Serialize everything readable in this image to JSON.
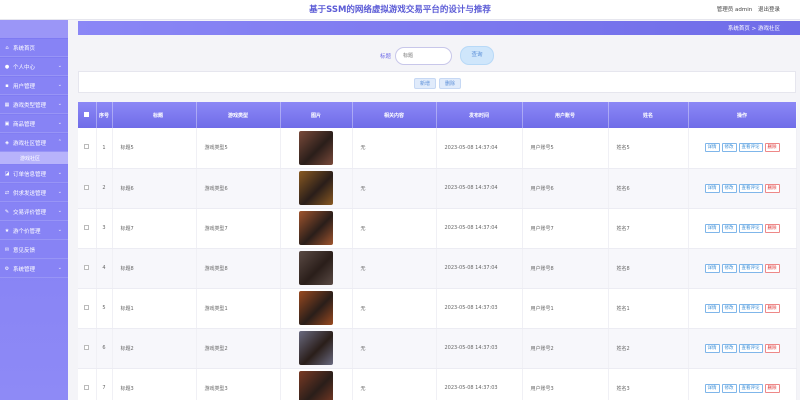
{
  "app": {
    "title": "基于SSM的网络虚拟游戏交易平台的设计与推荐",
    "user_label": "管理员 admin",
    "logout": "退出登录"
  },
  "sidebar": {
    "items": [
      {
        "label": "系统首页",
        "icon": "home-icon",
        "arrow": false
      },
      {
        "label": "个人中心",
        "icon": "user-icon",
        "arrow": true
      },
      {
        "label": "用户管理",
        "icon": "users-icon",
        "arrow": true
      },
      {
        "label": "游戏类型管理",
        "icon": "list-icon",
        "arrow": true
      },
      {
        "label": "商品管理",
        "icon": "goods-icon",
        "arrow": true
      },
      {
        "label": "游戏社区管理",
        "icon": "community-icon",
        "arrow": true,
        "expanded": true
      },
      {
        "label": "订单信息管理",
        "icon": "order-icon",
        "arrow": true
      },
      {
        "label": "供求发送管理",
        "icon": "supply-icon",
        "arrow": true
      },
      {
        "label": "交易评价管理",
        "icon": "review-icon",
        "arrow": true
      },
      {
        "label": "游个价管理",
        "icon": "star-icon",
        "arrow": true
      },
      {
        "label": "意见反馈",
        "icon": "feedback-icon",
        "arrow": false
      },
      {
        "label": "系统管理",
        "icon": "settings-icon",
        "arrow": true
      }
    ],
    "submenu": {
      "label": "游戏社区"
    }
  },
  "breadcrumb": {
    "home": "系统首页",
    "separator": ">",
    "current": "游戏社区"
  },
  "search": {
    "label": "标题",
    "placeholder": "标题",
    "button": "查询"
  },
  "actions": {
    "add": "新增",
    "delete": "删除"
  },
  "table": {
    "columns": [
      "序号",
      "标题",
      "游戏类型",
      "图片",
      "相关内容",
      "发布时间",
      "用户账号",
      "姓名",
      "操作"
    ],
    "row_actions": [
      "详情",
      "修改",
      "查看评论",
      "删除"
    ],
    "rows": [
      {
        "index": "1",
        "title": "标题5",
        "type": "游戏类型5",
        "content": "无",
        "time": "2023-05-08 14:37:04",
        "account": "用户账号5",
        "name": "姓名5",
        "image_color": "#7a4a3a"
      },
      {
        "index": "2",
        "title": "标题6",
        "type": "游戏类型6",
        "content": "无",
        "time": "2023-05-08 14:37:04",
        "account": "用户账号6",
        "name": "姓名6",
        "image_color": "#8a5a22"
      },
      {
        "index": "3",
        "title": "标题7",
        "type": "游戏类型7",
        "content": "无",
        "time": "2023-05-08 14:37:04",
        "account": "用户账号7",
        "name": "姓名7",
        "image_color": "#a0552e"
      },
      {
        "index": "4",
        "title": "标题8",
        "type": "游戏类型8",
        "content": "无",
        "time": "2023-05-08 14:37:04",
        "account": "用户账号8",
        "name": "姓名8",
        "image_color": "#5a4a44"
      },
      {
        "index": "5",
        "title": "标题1",
        "type": "游戏类型1",
        "content": "无",
        "time": "2023-05-08 14:37:03",
        "account": "用户账号1",
        "name": "姓名1",
        "image_color": "#9a4a20"
      },
      {
        "index": "6",
        "title": "标题2",
        "type": "游戏类型2",
        "content": "无",
        "time": "2023-05-08 14:37:03",
        "account": "用户账号2",
        "name": "姓名2",
        "image_color": "#6a6a80"
      },
      {
        "index": "7",
        "title": "标题3",
        "type": "游戏类型3",
        "content": "无",
        "time": "2023-05-08 14:37:03",
        "account": "用户账号3",
        "name": "姓名3",
        "image_color": "#7a3a24"
      }
    ]
  },
  "colors": {
    "accent": "#7d79f2",
    "link": "#3c8fd8",
    "danger": "#d33333"
  }
}
